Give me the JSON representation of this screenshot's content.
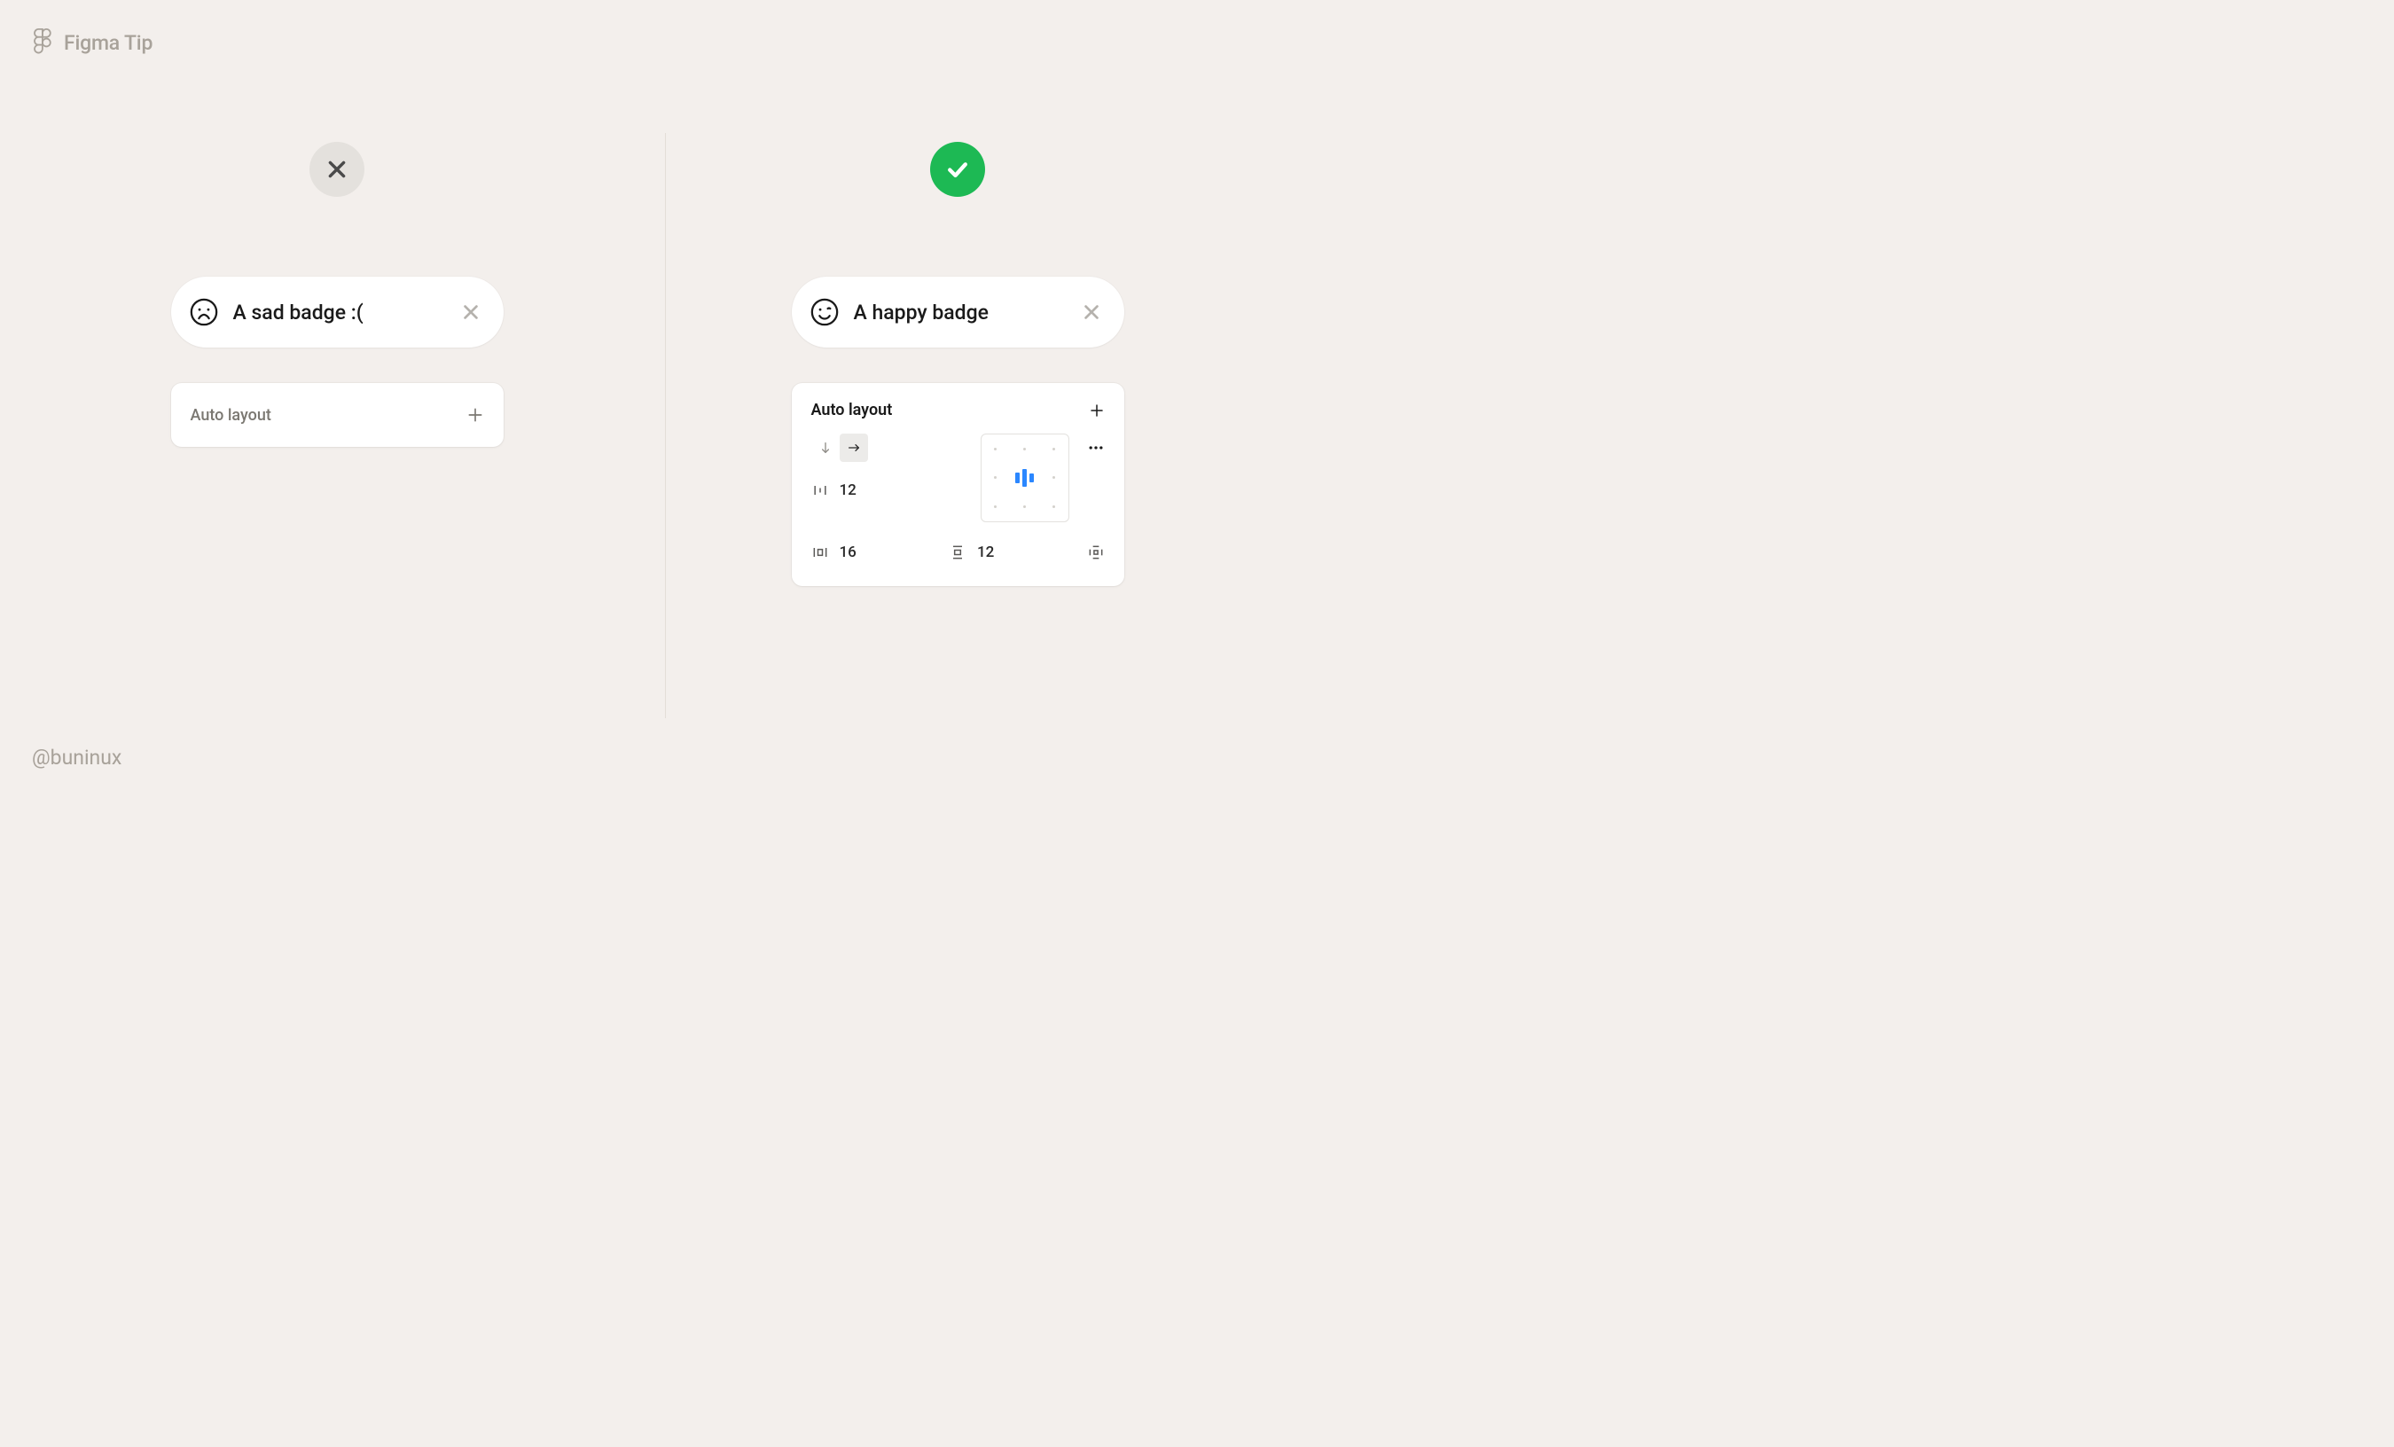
{
  "header": {
    "title": "Figma Tip"
  },
  "footer": {
    "credit": "@buninux"
  },
  "left": {
    "badge_text": "A sad badge :(",
    "panel_title": "Auto layout"
  },
  "right": {
    "badge_text": "A happy badge",
    "panel": {
      "title": "Auto layout",
      "item_spacing": 12,
      "padding_horizontal": 16,
      "padding_vertical": 12
    }
  }
}
